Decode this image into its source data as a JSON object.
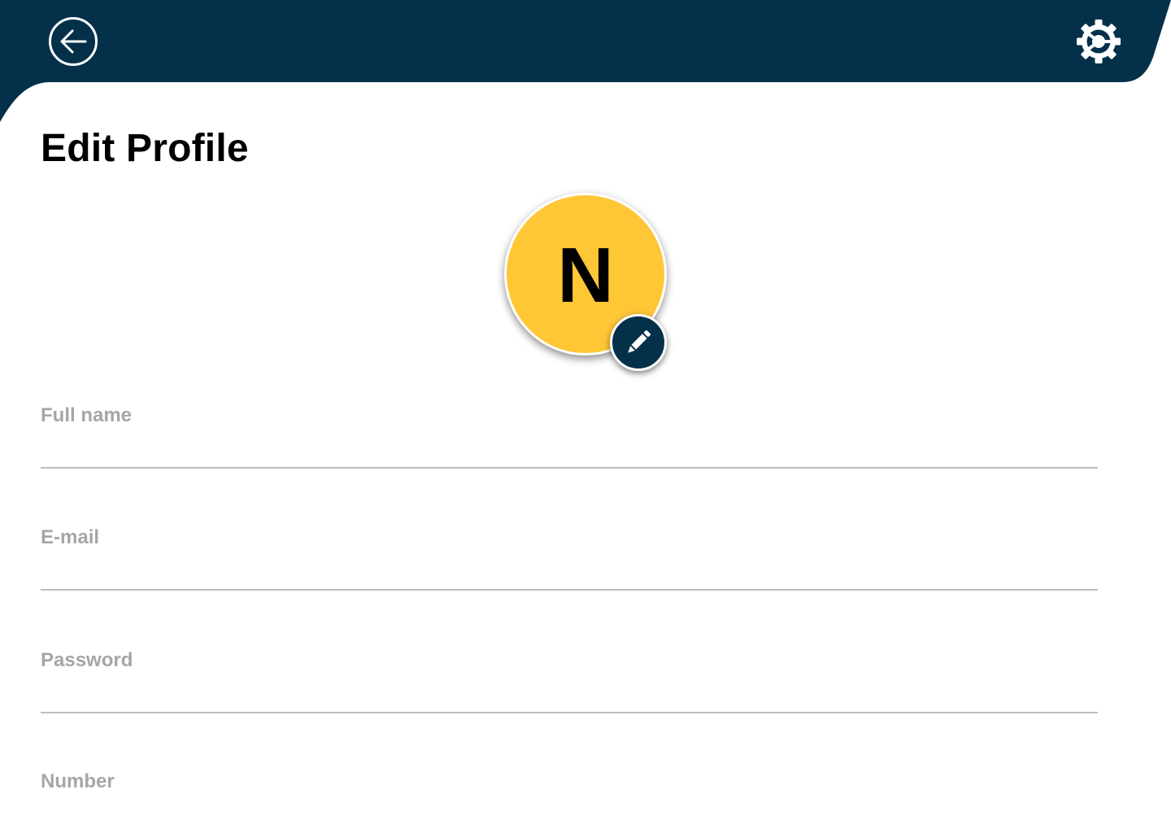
{
  "header": {
    "back_icon": "arrow-left-circle-icon",
    "settings_icon": "gear-icon",
    "background_color": "#04304A"
  },
  "page": {
    "title": "Edit Profile"
  },
  "avatar": {
    "initial": "N",
    "background_color": "#FFC636",
    "edit_icon": "pencil-icon",
    "edit_button_color": "#04304A"
  },
  "form": {
    "full_name": {
      "label": "Full name",
      "value": ""
    },
    "email": {
      "label": "E-mail",
      "value": ""
    },
    "password": {
      "label": "Password",
      "value": ""
    },
    "number": {
      "label": "Number",
      "value": ""
    }
  }
}
